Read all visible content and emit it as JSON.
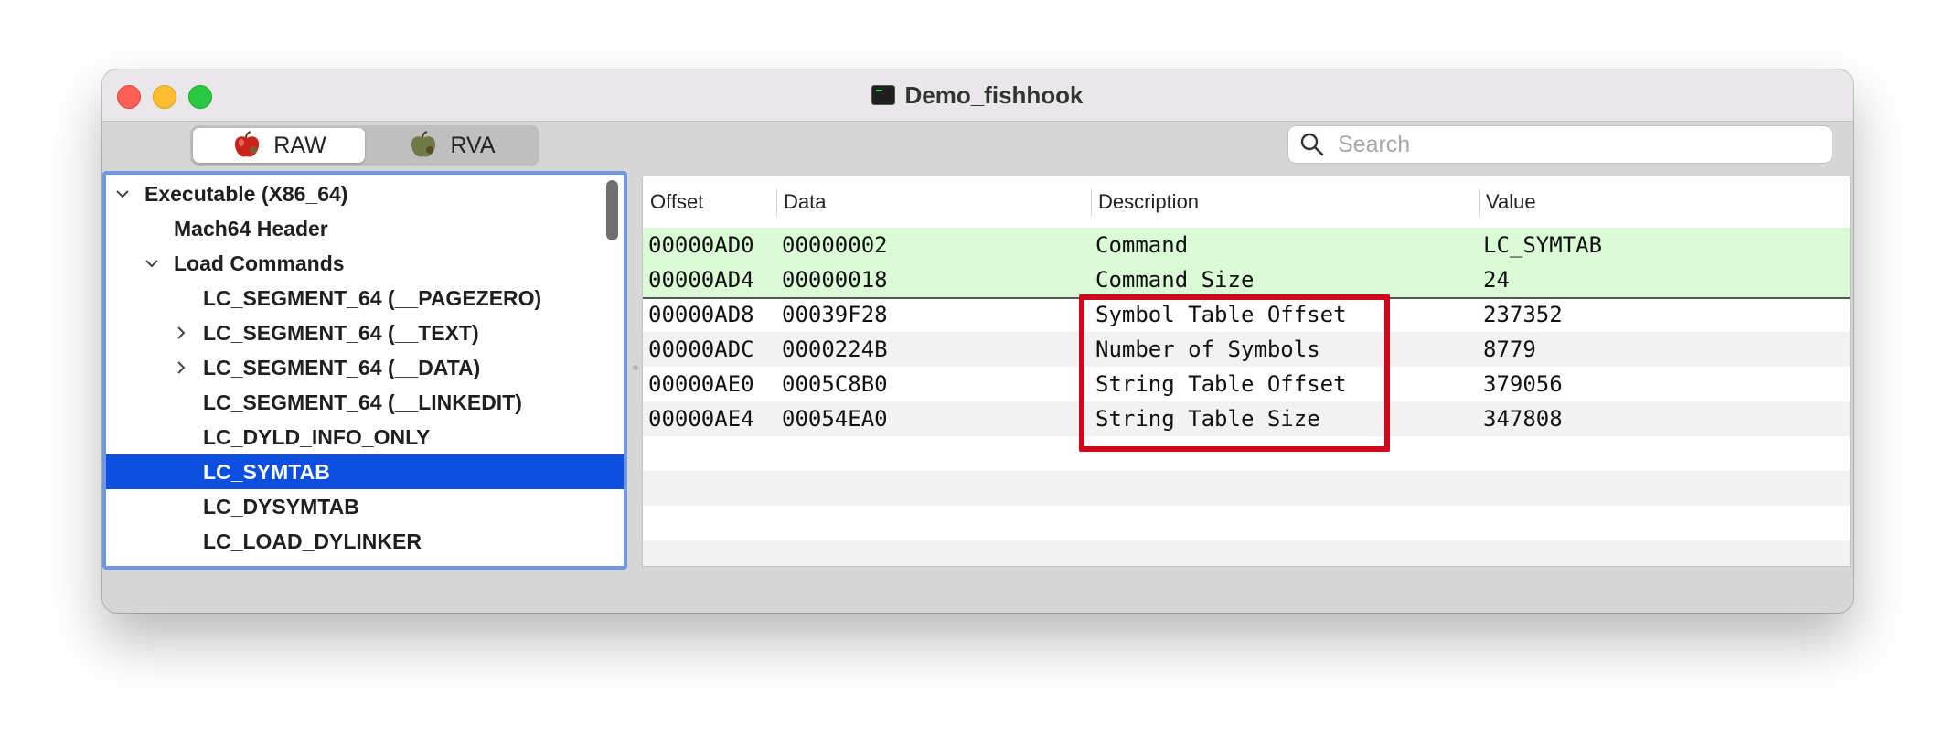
{
  "window": {
    "title": "Demo_fishhook"
  },
  "toolbar": {
    "raw_label": "RAW",
    "rva_label": "RVA",
    "search_placeholder": "Search"
  },
  "tree": {
    "items": [
      {
        "label": "Executable  (X86_64)",
        "level": 0,
        "chevron": "down",
        "selected": false
      },
      {
        "label": "Mach64 Header",
        "level": 1,
        "chevron": "none",
        "selected": false
      },
      {
        "label": "Load Commands",
        "level": 1,
        "chevron": "down",
        "selected": false
      },
      {
        "label": "LC_SEGMENT_64 (__PAGEZERO)",
        "level": 2,
        "chevron": "none",
        "selected": false
      },
      {
        "label": "LC_SEGMENT_64 (__TEXT)",
        "level": 2,
        "chevron": "right",
        "selected": false
      },
      {
        "label": "LC_SEGMENT_64 (__DATA)",
        "level": 2,
        "chevron": "right",
        "selected": false
      },
      {
        "label": "LC_SEGMENT_64 (__LINKEDIT)",
        "level": 2,
        "chevron": "none",
        "selected": false
      },
      {
        "label": "LC_DYLD_INFO_ONLY",
        "level": 2,
        "chevron": "none",
        "selected": false
      },
      {
        "label": "LC_SYMTAB",
        "level": 2,
        "chevron": "none",
        "selected": true
      },
      {
        "label": "LC_DYSYMTAB",
        "level": 2,
        "chevron": "none",
        "selected": false
      },
      {
        "label": "LC_LOAD_DYLINKER",
        "level": 2,
        "chevron": "none",
        "selected": false
      }
    ]
  },
  "table": {
    "columns": [
      "Offset",
      "Data",
      "Description",
      "Value"
    ],
    "rows": [
      {
        "offset": "00000AD0",
        "data": "00000002",
        "description": "Command",
        "value": "LC_SYMTAB",
        "group": "header"
      },
      {
        "offset": "00000AD4",
        "data": "00000018",
        "description": "Command Size",
        "value": "24",
        "group": "header"
      },
      {
        "offset": "00000AD8",
        "data": "00039F28",
        "description": "Symbol Table Offset",
        "value": "237352",
        "group": "body"
      },
      {
        "offset": "00000ADC",
        "data": "0000224B",
        "description": "Number of Symbols",
        "value": "8779",
        "group": "body"
      },
      {
        "offset": "00000AE0",
        "data": "0005C8B0",
        "description": "String Table Offset",
        "value": "379056",
        "group": "body"
      },
      {
        "offset": "00000AE4",
        "data": "00054EA0",
        "description": "String Table Size",
        "value": "347808",
        "group": "body"
      }
    ],
    "empty_rows": 4
  },
  "colors": {
    "header_row": "#dafbd6",
    "stripe": "#f1f2f1",
    "selection": "#0b4ee0",
    "highlight_box": "#d0081b"
  }
}
